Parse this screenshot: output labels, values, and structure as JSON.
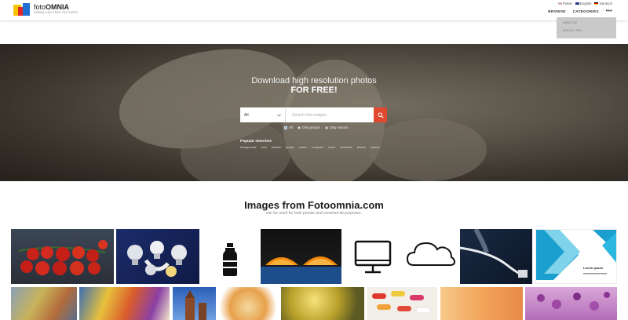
{
  "header": {
    "logo_prefix": "foto",
    "logo_bold": "OMNIA",
    "logo_tagline": "DOWNLOAD FREE PICTURES",
    "languages": [
      "Polski",
      "English",
      "Deutsch"
    ],
    "nav": {
      "browse": "BROWSE",
      "categories": "CATEGORIES",
      "more": "•••"
    },
    "dropdown_items": [
      "ABOUT US",
      "SIGN IN / JOIN"
    ]
  },
  "hero": {
    "title": "Download high resolution photos",
    "subtitle": "FOR FREE!",
    "search": {
      "category_value": "All",
      "placeholder": "Search free images...",
      "button_icon": "search-icon"
    },
    "radio_options": [
      {
        "label": "All",
        "selected": true
      },
      {
        "label": "Only photos",
        "selected": false
      },
      {
        "label": "Only vectors",
        "selected": false
      }
    ],
    "popular_label": "Popular searches",
    "popular_tags": [
      "backgrounds",
      "food",
      "animals",
      "people",
      "nature",
      "computer",
      "music",
      "christmas",
      "flowers",
      "cartoon"
    ]
  },
  "section": {
    "title": "Images from Fotoomnia.com",
    "subtitle": "can be used for both private and commercial purposes."
  },
  "gallery_row1": [
    {
      "name": "tomatoes",
      "icon": "tomato-photo"
    },
    {
      "name": "light-bulbs",
      "icon": "bulb-photo"
    },
    {
      "name": "bottle",
      "icon": "bottle-icon"
    },
    {
      "name": "orange-halves",
      "icon": "orange-photo"
    },
    {
      "name": "monitor",
      "icon": "monitor-icon"
    },
    {
      "name": "cloud",
      "icon": "cloud-icon"
    },
    {
      "name": "network-cable",
      "icon": "cable-photo"
    },
    {
      "name": "business-brochure",
      "icon": "brochure-graphic"
    }
  ],
  "brochure_label": "Lorem ipsum",
  "gallery_row2": [
    "paint-palette",
    "paint-strokes",
    "church-tower",
    "autumn-leaves",
    "sunlit-leaves",
    "pills",
    "orange-gradient",
    "purple-flowers"
  ]
}
